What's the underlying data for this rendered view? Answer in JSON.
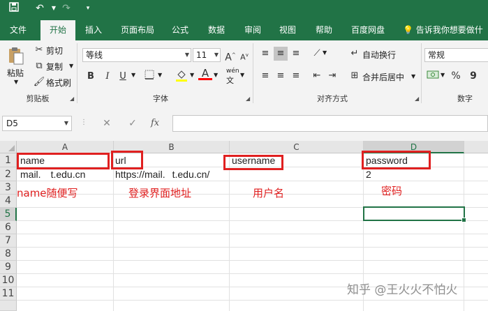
{
  "quick_access": {
    "save_icon": "save-icon",
    "undo_icon": "undo-icon",
    "redo_icon": "redo-icon",
    "customize_icon": "customize-icon"
  },
  "tabs": [
    "文件",
    "开始",
    "插入",
    "页面布局",
    "公式",
    "数据",
    "审阅",
    "视图",
    "帮助",
    "百度网盘"
  ],
  "active_tab": "开始",
  "tell_me": "告诉我你想要做什",
  "ribbon": {
    "clipboard": {
      "paste": "粘贴",
      "cut": "剪切",
      "copy": "复制",
      "format_painter": "格式刷",
      "label": "剪贴板"
    },
    "font": {
      "name": "等线",
      "size": "11",
      "grow": "A",
      "shrink": "A",
      "bold": "B",
      "italic": "I",
      "underline": "U",
      "phonetic": "wén",
      "label": "字体",
      "fill_color": "#ffff00",
      "font_color": "#ff0000"
    },
    "alignment": {
      "wrap": "自动换行",
      "merge": "合并后居中",
      "label": "对齐方式"
    },
    "number": {
      "format": "常规",
      "percent": "%",
      "comma": "9",
      "label": "数字"
    }
  },
  "formula_bar": {
    "name_box": "D5",
    "cancel": "✕",
    "enter": "✓",
    "fx": "fx",
    "value": ""
  },
  "columns": [
    "A",
    "B",
    "C",
    "D"
  ],
  "selected_column": "D",
  "rows": [
    "1",
    "2",
    "3",
    "4",
    "5",
    "6",
    "7",
    "8",
    "9",
    "10",
    "11"
  ],
  "selected_row": "5",
  "cells": {
    "A1": "name",
    "B1": "url",
    "C1": "username",
    "D1": "password",
    "A2": "mail.",
    "A2b": "t.edu.cn",
    "B2": "https://mail.",
    "B2b": "t.edu.cn/",
    "D2": "2"
  },
  "annotations": {
    "name": "name随便写",
    "url": "登录界面地址",
    "username": "用户名",
    "password": "密码"
  },
  "watermark": "知乎 @王火火不怕火",
  "colors": {
    "excel_green": "#217346",
    "annotation_red": "#e02020"
  }
}
